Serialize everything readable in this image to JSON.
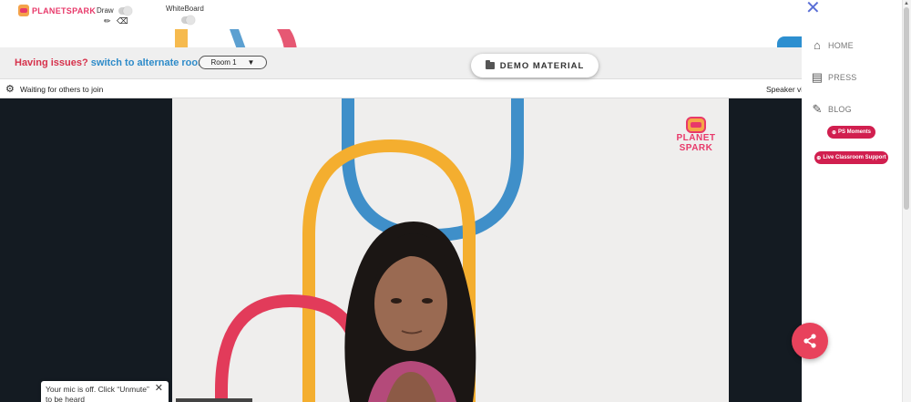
{
  "brand": {
    "logo_text": "PLANETSPARK"
  },
  "toolbar": {
    "draw_label": "Draw",
    "whiteboard_label": "WhiteBoard",
    "pencil_icon": "✏",
    "eraser_icon": "⌫"
  },
  "issues": {
    "prefix": "Having issues?",
    "link": "switch to alternate room",
    "room_selected": "Room 1",
    "room_arrow": "▼"
  },
  "demo_material": {
    "label": "DEMO MATERIAL"
  },
  "status": {
    "waiting": "Waiting for others to join",
    "speaker_view": "Speaker vi"
  },
  "video": {
    "watermark_line1": "PLANET",
    "watermark_line2": "SPARK"
  },
  "mic_toast": {
    "text": "Your mic is off. Click “Unmute” to be heard",
    "close": "✕"
  },
  "sidebar": {
    "close": "✕",
    "items": [
      {
        "label": "HOME",
        "icon": "home-icon"
      },
      {
        "label": "PRESS",
        "icon": "newspaper-icon"
      },
      {
        "label": "BLOG",
        "icon": "pencil-icon"
      }
    ],
    "pills": [
      {
        "label": "PS Moments"
      },
      {
        "label": "Live Classroom Support"
      }
    ]
  },
  "colors": {
    "accent_red": "#d6324c",
    "accent_blue": "#2e8bc9",
    "pill_red": "#d11f4f",
    "share_button": "#e8425c",
    "arch_blue": "#3f8fc9",
    "arch_yellow": "#f4ae2f",
    "arch_red": "#e23b5a"
  }
}
